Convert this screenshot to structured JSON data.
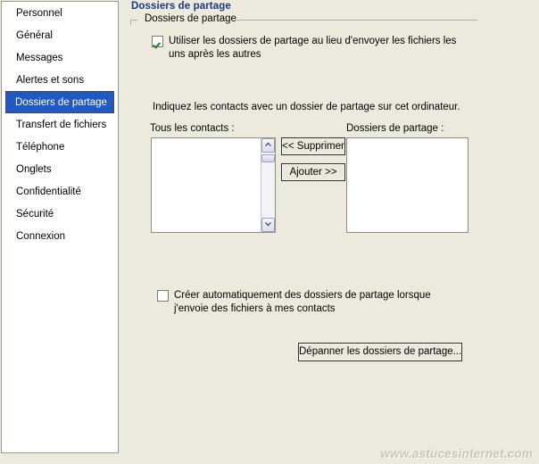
{
  "window": {
    "title": "Dossiers de partage"
  },
  "sidebar": {
    "items": [
      {
        "label": "Personnel",
        "selected": false
      },
      {
        "label": "Général",
        "selected": false
      },
      {
        "label": "Messages",
        "selected": false
      },
      {
        "label": "Alertes et sons",
        "selected": false
      },
      {
        "label": "Dossiers de partage",
        "selected": true
      },
      {
        "label": "Transfert de fichiers",
        "selected": false
      },
      {
        "label": "Téléphone",
        "selected": false
      },
      {
        "label": "Onglets",
        "selected": false
      },
      {
        "label": "Confidentialité",
        "selected": false
      },
      {
        "label": "Sécurité",
        "selected": false
      },
      {
        "label": "Connexion",
        "selected": false
      }
    ]
  },
  "main": {
    "page_title": "Dossiers de partage",
    "group_box_label": "Dossiers de partage",
    "use_shared_folders_checkbox": {
      "label": "Utiliser les dossiers de partage au lieu d'envoyer les fichiers les uns après les autres",
      "checked": true
    },
    "instruction": "Indiquez les contacts avec un dossier de partage sur cet ordinateur.",
    "all_contacts_label": "Tous les contacts :",
    "all_contacts_items": [],
    "shared_folders_label": "Dossiers de partage :",
    "shared_folders_items": [],
    "remove_button": "<< Supprimer",
    "add_button": "Ajouter >>",
    "auto_create_checkbox": {
      "label": "Créer automatiquement des dossiers de partage lorsque j'envoie des fichiers à mes contacts",
      "checked": false
    },
    "troubleshoot_button": "Dépanner les dossiers de partage..."
  },
  "watermark": {
    "text": "www.astucesinternet.com"
  },
  "colors": {
    "window_background": "#eceadd",
    "selection_blue": "#2159c4",
    "title_blue": "#1a3a7a",
    "check_green": "#237a23",
    "panel_white": "#ffffff",
    "watermark_gray": "#c9c6b4"
  }
}
